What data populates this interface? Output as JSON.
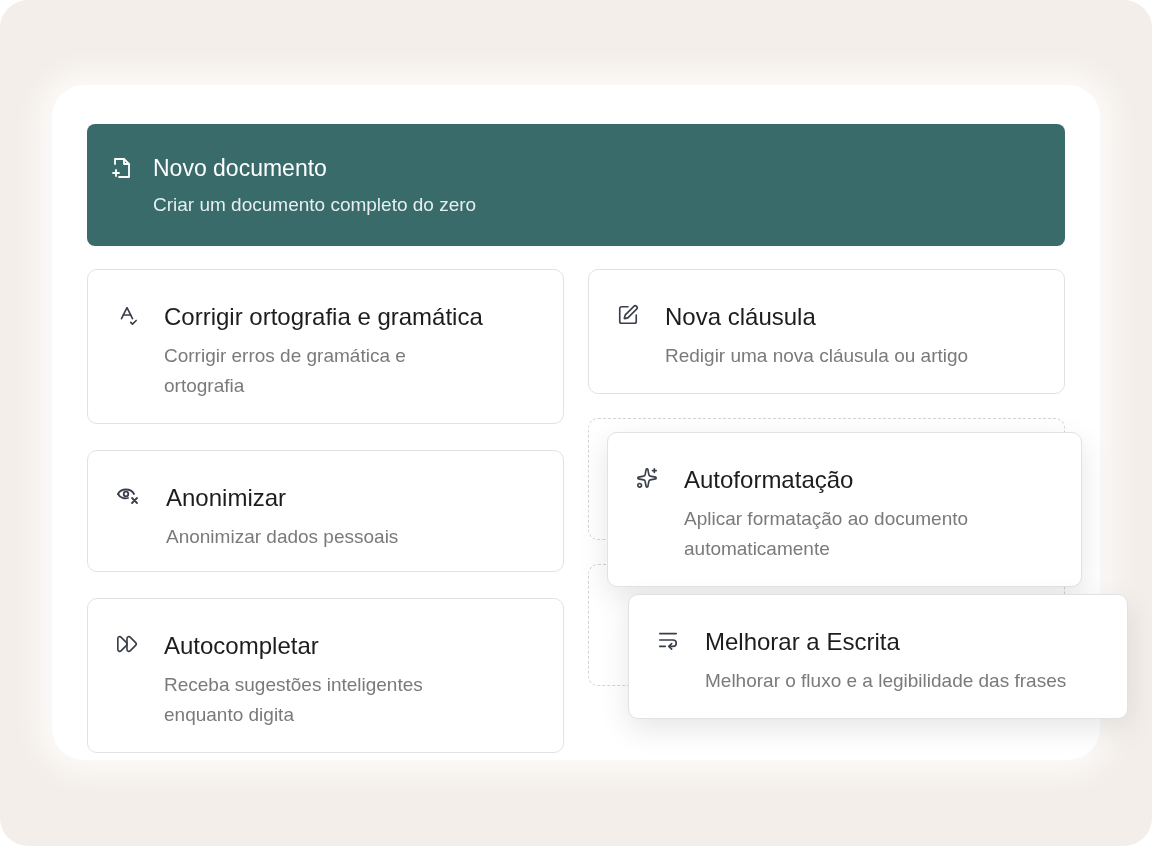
{
  "featured": {
    "title": "Novo documento",
    "description": "Criar um documento completo do zero"
  },
  "left_column": [
    {
      "title": "Corrigir ortografia e gramática",
      "description": "Corrigir erros de gramática e ortografia",
      "dragging": false
    },
    {
      "title": "Anonimizar",
      "description": "Anonimizar dados pessoais",
      "dragging": false
    },
    {
      "title": "Autocompletar",
      "description": "Receba sugestões inteligentes enquanto digita",
      "dragging": false
    }
  ],
  "right_column": [
    {
      "title": "Nova cláusula",
      "description": "Redigir uma nova cláusula ou artigo",
      "dragging": false
    },
    {
      "title": "Autoformatação",
      "description": "Aplicar formatação ao documento automaticamente",
      "dragging": true
    },
    {
      "title": "Melhorar a Escrita",
      "description": "Melhorar o fluxo e a legibilidade das frases",
      "dragging": true
    }
  ]
}
